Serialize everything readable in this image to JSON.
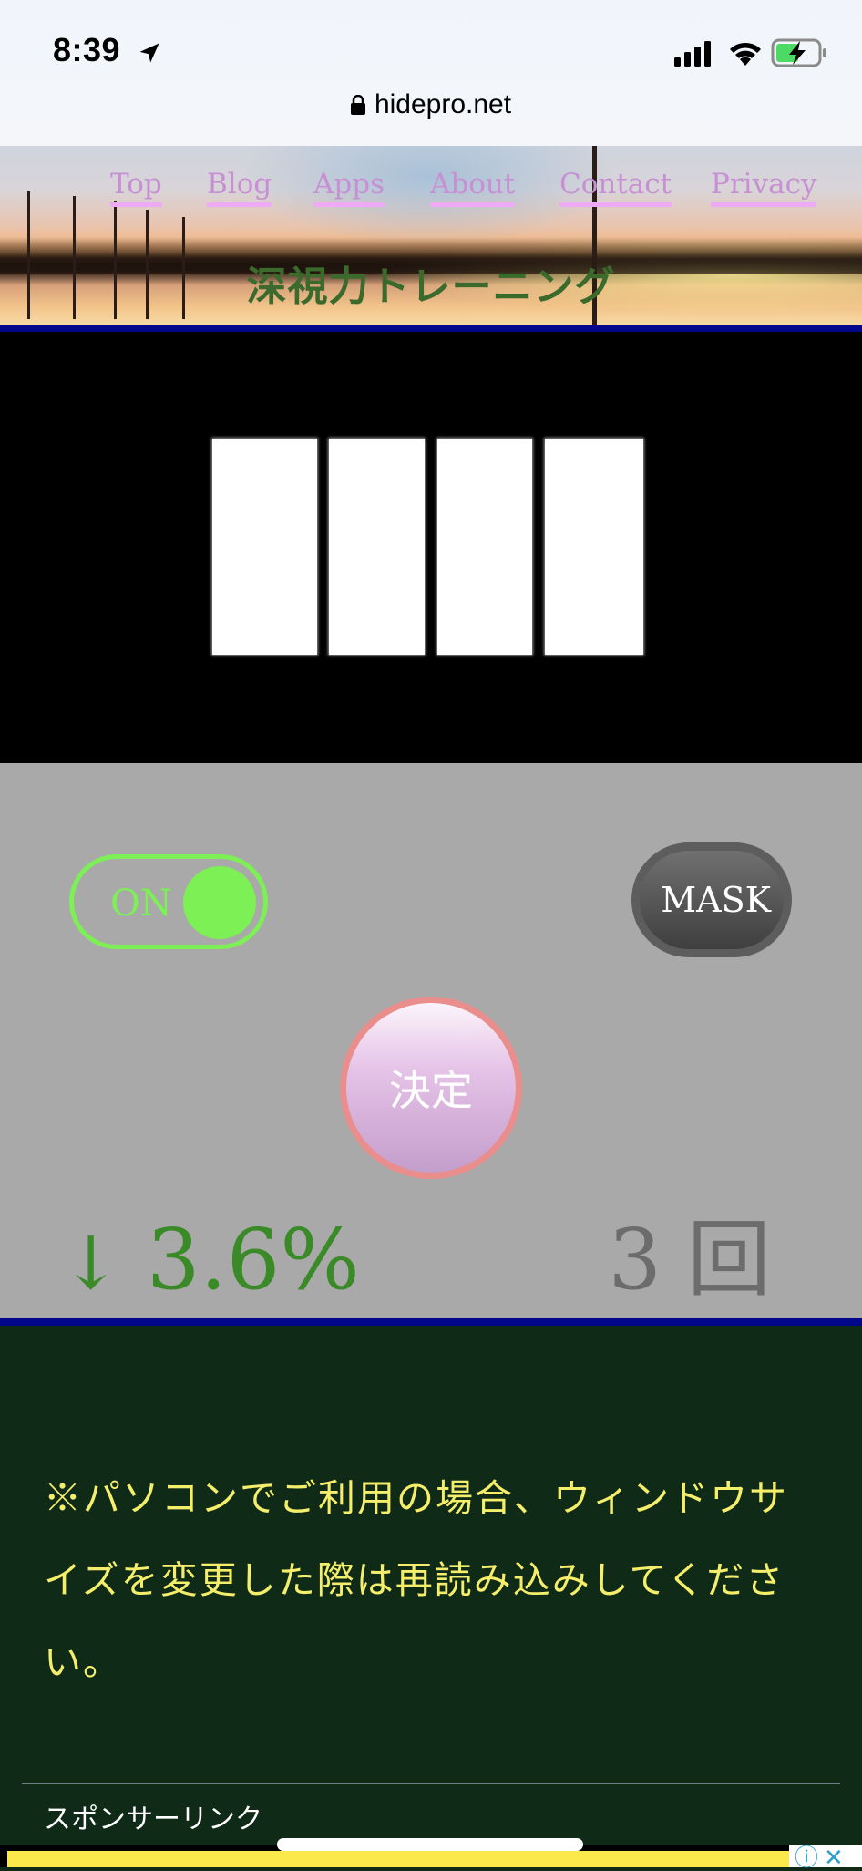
{
  "status_bar": {
    "time": "8:39",
    "icons": [
      "location-arrow-icon",
      "cellular-signal-icon",
      "wifi-icon",
      "battery-charging-icon"
    ]
  },
  "browser": {
    "url": "hidepro.net",
    "secure_icon": "lock-icon"
  },
  "header": {
    "nav": [
      {
        "label": "Top"
      },
      {
        "label": "Blog"
      },
      {
        "label": "Apps"
      },
      {
        "label": "About"
      },
      {
        "label": "Contact"
      },
      {
        "label": "Privacy"
      }
    ],
    "site_title": "深視力トレーニング"
  },
  "stage": {
    "bars": 4,
    "background_color": "#000000",
    "bar_color": "#ffffff"
  },
  "controls": {
    "toggle": {
      "label": "ON",
      "state": "on",
      "color": "#7cf055"
    },
    "mask_button": {
      "label": "MASK"
    },
    "decide_button": {
      "label": "決定"
    }
  },
  "result": {
    "trend_icon": "down-arrow-icon",
    "trend_symbol": "↓",
    "error_percent": "3.6%",
    "count_value": "3",
    "count_unit": "回"
  },
  "notice": {
    "text": "※パソコンでご利用の場合、ウィンドウサイズを変更した際は再読み込みしてください。"
  },
  "sponsor": {
    "label": "スポンサーリンク",
    "ad_info_icon": "ⓘ",
    "ad_close_icon": "✕"
  },
  "colors": {
    "accent_blue": "#02068a",
    "panel_gray": "#a9a9a9",
    "footer_green": "#102a18",
    "notice_yellow": "#f4ee6a",
    "result_green": "#3a8a28",
    "nav_text": "#c890d4"
  }
}
